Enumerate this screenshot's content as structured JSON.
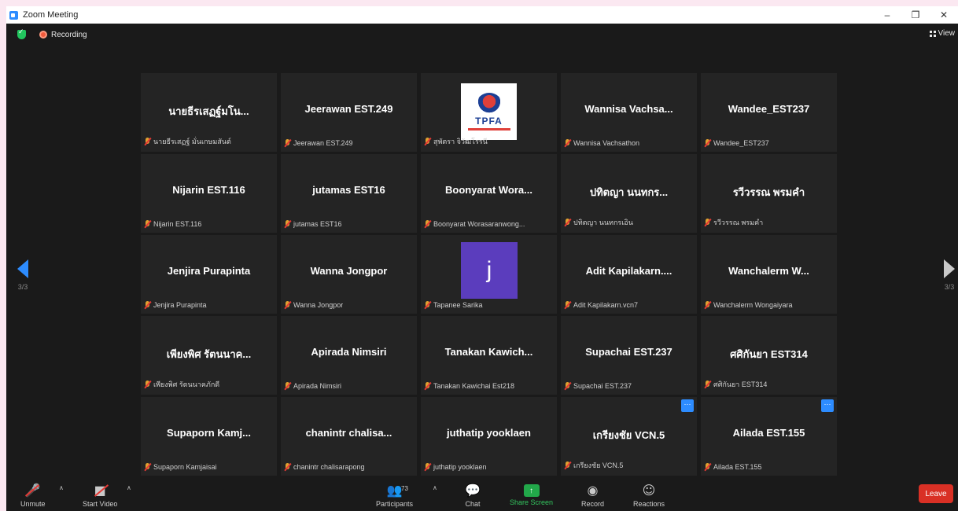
{
  "window": {
    "title": "Zoom Meeting",
    "minimize": "–",
    "restore": "❐",
    "close": "✕"
  },
  "status": {
    "recording": "Recording",
    "view": "View"
  },
  "pagination": {
    "left": "3/3",
    "right": "3/3"
  },
  "tiles": [
    {
      "name": "นายธีรเสฏฐ์มโน...",
      "caption": "นายธีรเสฏฐ์ มั่นเกษมสันต์"
    },
    {
      "name": "Jeerawan EST.249",
      "caption": "Jeerawan EST.249"
    },
    {
      "name": "",
      "caption": "สุพัตรา จิวัฒโรรนี",
      "logo_text": "TPFA"
    },
    {
      "name": "Wannisa Vachsa...",
      "caption": "Wannisa Vachsathon"
    },
    {
      "name": "Wandee_EST237",
      "caption": "Wandee_EST237"
    },
    {
      "name": "Nijarin EST.116",
      "caption": "Nijarin EST.116"
    },
    {
      "name": "jutamas EST16",
      "caption": "jutamas EST16"
    },
    {
      "name": "Boonyarat Wora...",
      "caption": "Boonyarat Worasaranwong..."
    },
    {
      "name": "ปทิตญา นนทกร...",
      "caption": "ปทิตญา นนทกรเอิน"
    },
    {
      "name": "รวีวรรณ พรมคำ",
      "caption": "รวีวรรณ พรมคำ"
    },
    {
      "name": "Jenjira Purapinta",
      "caption": "Jenjira Purapinta"
    },
    {
      "name": "Wanna Jongpor",
      "caption": "Wanna Jongpor"
    },
    {
      "name": "",
      "caption": "Tapanee Sarika",
      "avatar_letter": "j"
    },
    {
      "name": "Adit Kapilakarn....",
      "caption": "Adit Kapilakarn.vcn7"
    },
    {
      "name": "Wanchalerm W...",
      "caption": "Wanchalerm Wongaiyara"
    },
    {
      "name": "เพียงพิศ รัตนนาค...",
      "caption": "เพียงพิศ รัตนนาคภักดี"
    },
    {
      "name": "Apirada Nimsiri",
      "caption": "Apirada Nimsiri"
    },
    {
      "name": "Tanakan Kawich...",
      "caption": "Tanakan Kawichai Est218"
    },
    {
      "name": "Supachai EST.237",
      "caption": "Supachai EST.237"
    },
    {
      "name": "ศศิกันยา EST314",
      "caption": "ศศิกันยา EST314"
    },
    {
      "name": "Supaporn Kamj...",
      "caption": "Supaporn Kamjaisai"
    },
    {
      "name": "chanintr chalisa...",
      "caption": "chanintr chalisarapong"
    },
    {
      "name": "juthatip yooklaen",
      "caption": "juthatip yooklaen"
    },
    {
      "name": "เกรียงชัย VCN.5",
      "caption": "เกรียงชัย VCN.5",
      "more": "···"
    },
    {
      "name": "Ailada EST.155",
      "caption": "Ailada EST.155",
      "more": "···"
    }
  ],
  "toolbar": {
    "unmute": "Unmute",
    "start_video": "Start Video",
    "participants": "Participants",
    "participants_count": "73",
    "chat": "Chat",
    "share_screen": "Share Screen",
    "record": "Record",
    "reactions": "Reactions",
    "leave": "Leave"
  }
}
